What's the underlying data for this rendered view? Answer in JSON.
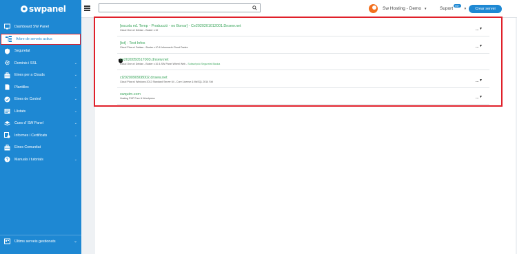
{
  "brand": {
    "name": "swpanel"
  },
  "sidebar": {
    "items": [
      {
        "label": "Dashboard SW Panel",
        "icon": "dashboard-icon",
        "chevron": false,
        "active": false
      },
      {
        "label": "Arbre de serveis actius",
        "icon": "tree-icon",
        "chevron": false,
        "active": true
      },
      {
        "label": "Seguretat",
        "icon": "shield-icon",
        "chevron": false,
        "active": false
      },
      {
        "label": "Dominis i SSL",
        "icon": "gear-icon",
        "chevron": true,
        "active": false
      },
      {
        "label": "Eines per a Clouds",
        "icon": "toolbox-icon",
        "chevron": true,
        "active": false
      },
      {
        "label": "Plantilles",
        "icon": "document-icon",
        "chevron": true,
        "active": false
      },
      {
        "label": "Eines de Control",
        "icon": "check-icon",
        "chevron": true,
        "active": false
      },
      {
        "label": "Llistats",
        "icon": "list-icon",
        "chevron": true,
        "active": false
      },
      {
        "label": "Cues d' SW Panel",
        "icon": "layers-icon",
        "chevron": true,
        "active": false
      },
      {
        "label": "Informes i Certificats",
        "icon": "report-icon",
        "chevron": true,
        "active": false
      },
      {
        "label": "Eines Comunitat",
        "icon": "toolbox-icon",
        "chevron": false,
        "active": false
      },
      {
        "label": "Manuals i tutorials",
        "icon": "help-icon",
        "chevron": true,
        "active": false
      }
    ],
    "bottom": {
      "label": "Últims serveis gestionats",
      "icon": "history-icon"
    }
  },
  "topbar": {
    "search_placeholder": "",
    "account_name": "Sw Hosting - Demo",
    "support_label": "Suport",
    "support_badge": "99+",
    "create_button": "Crear servei"
  },
  "servers": [
    {
      "name": "[escola m1 Temp - Producció - no Borrar] - Ce2020201012001.Dnsew.net",
      "desc": "Cloud One w/ Debian - Buster v.10",
      "extra": "",
      "icon": ""
    },
    {
      "name": "[tst] - Test Infos",
      "desc": "Cloud Plus w/ Debian - Buster v.10 & Informació Cloud Dades",
      "extra": "",
      "icon": ""
    },
    {
      "name": "ce2020050517003.dnsew.net",
      "desc": "Cloud One w/ Debian - Buster v.10 & SW Panel Wheel Web - ",
      "extra": "Subscripció Seguretat Bàsica",
      "icon": "shield-icon"
    },
    {
      "name": "cl2020090908002.dnsew.net",
      "desc": "Cloud Plus w/ Windows 2012 Standard Server 64 - Core License & MsSQL 2014 Std",
      "extra": "",
      "icon": ""
    },
    {
      "name": "swquim.com",
      "desc": "Hosting PHP Free & Wordpress",
      "extra": "",
      "icon": ""
    }
  ],
  "colors": {
    "primary": "#1e88d3",
    "accent_orange": "#f3701e",
    "highlight": "#e0202a",
    "link_green": "#3aa55b"
  }
}
